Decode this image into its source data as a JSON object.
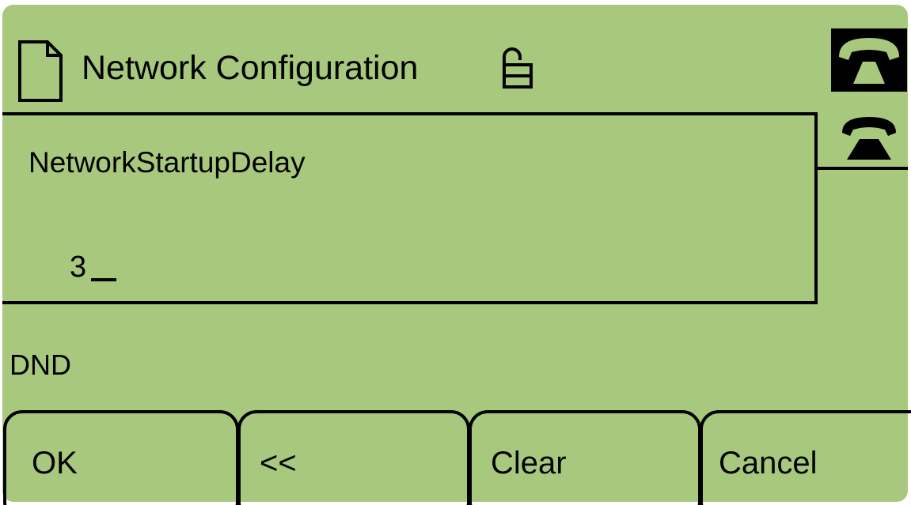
{
  "header": {
    "title": "Network Configuration",
    "left_icon": "document-icon",
    "lock_icon": "unlocked-padlock-icon"
  },
  "lines": [
    {
      "icon": "phone-handset-offhook-icon",
      "selected": true
    },
    {
      "icon": "phone-handset-icon",
      "selected": false
    }
  ],
  "editor": {
    "parameter_name": "NetworkStartupDelay",
    "value": "3",
    "cursor": "_"
  },
  "status": {
    "text": "DND"
  },
  "softkeys": [
    {
      "label": "OK"
    },
    {
      "label": "<<"
    },
    {
      "label": "Clear"
    },
    {
      "label": "Cancel"
    }
  ],
  "colors": {
    "lcd_background": "#a8c97d",
    "foreground": "#000000"
  }
}
